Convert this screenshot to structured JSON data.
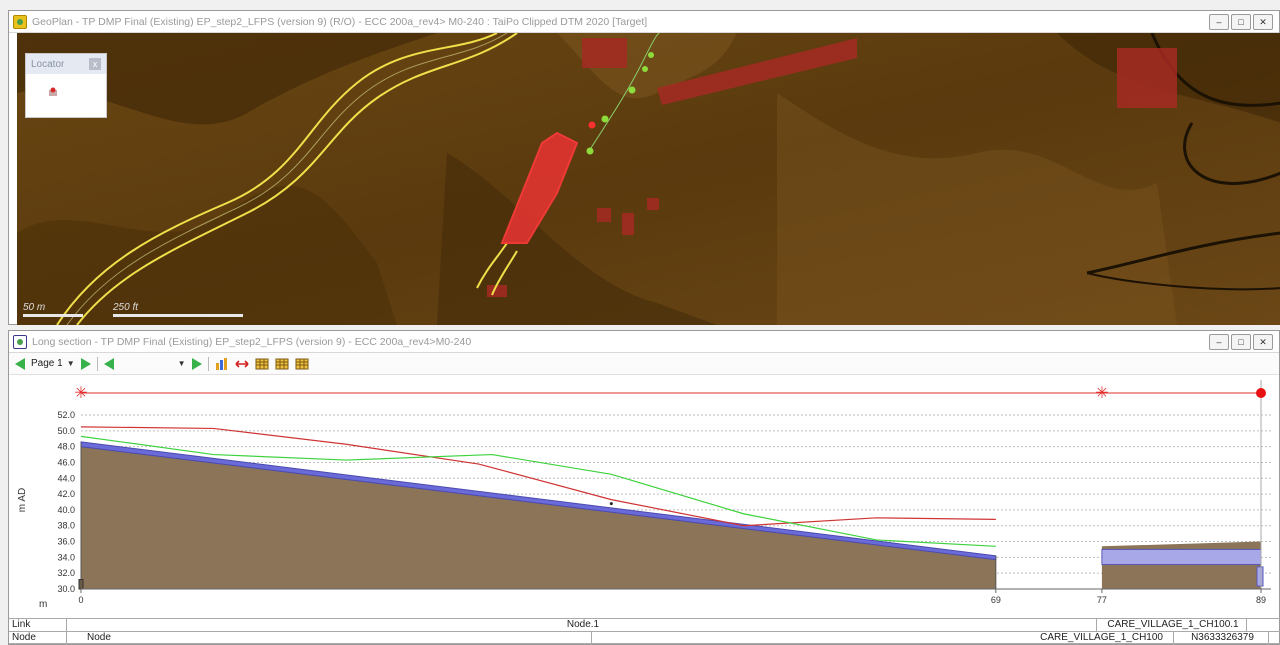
{
  "geoplan": {
    "title": "GeoPlan - TP DMP Final (Existing) EP_step2_LFPS (version 9) (R/O) - ECC 200a_rev4> M0-240 : TaiPo Clipped DTM 2020 [Target]",
    "locator_title": "Locator",
    "locator_close": "x",
    "scale_m": "50 m",
    "scale_ft": "250 ft"
  },
  "window_buttons": {
    "minimize": "–",
    "restore": "□",
    "close": "✕"
  },
  "longsection": {
    "title": "Long section - TP DMP Final (Existing) EP_step2_LFPS (version 9) - ECC 200a_rev4>M0-240",
    "page_label": "Page 1",
    "ylabel": "m AD",
    "xunit": "m"
  },
  "chart_data": {
    "type": "line",
    "ylim": [
      30,
      52
    ],
    "yticks": [
      "52.0",
      "50.0",
      "48.0",
      "46.0",
      "44.0",
      "42.0",
      "40.0",
      "38.0",
      "36.0",
      "34.0",
      "32.0",
      "30.0"
    ],
    "xlim": [
      0,
      89
    ],
    "xticks": [
      "0",
      "69",
      "77",
      "89"
    ],
    "ground_level": {
      "x": [
        0,
        10,
        20,
        30,
        40,
        50,
        60,
        69
      ],
      "y": [
        50.5,
        50.3,
        48.3,
        45.8,
        41.3,
        38.0,
        39.0,
        38.8
      ]
    },
    "bank_level": {
      "x": [
        0,
        10,
        20,
        31,
        40,
        50,
        60,
        69
      ],
      "y": [
        49.3,
        47.0,
        46.3,
        47.0,
        44.5,
        39.5,
        36.2,
        35.4
      ]
    },
    "pipe_soffit": {
      "x": [
        0,
        69
      ],
      "y": [
        48.6,
        34.2
      ]
    },
    "pipe_invert": {
      "x": [
        0,
        69
      ],
      "y": [
        48.0,
        33.7
      ]
    },
    "second_pipe": {
      "x": [
        77,
        89
      ],
      "top": 35.0,
      "bottom": 33.1,
      "ground": [
        35.4,
        36.0
      ]
    },
    "colors": {
      "ground": "#d03434",
      "bank": "#3fd23f",
      "pipe": "#6a6ad8",
      "fill": "#8c7458",
      "node_line": "#e23030"
    }
  },
  "table": {
    "row1_label": "Link",
    "row1_value": "Node.1",
    "row1_right": "CARE_VILLAGE_1_CH100.1",
    "row2_label": "Node",
    "row2_value": "Node",
    "row2_mid": "CARE_VILLAGE_1_CH100",
    "row2_right": "N3633326379"
  }
}
